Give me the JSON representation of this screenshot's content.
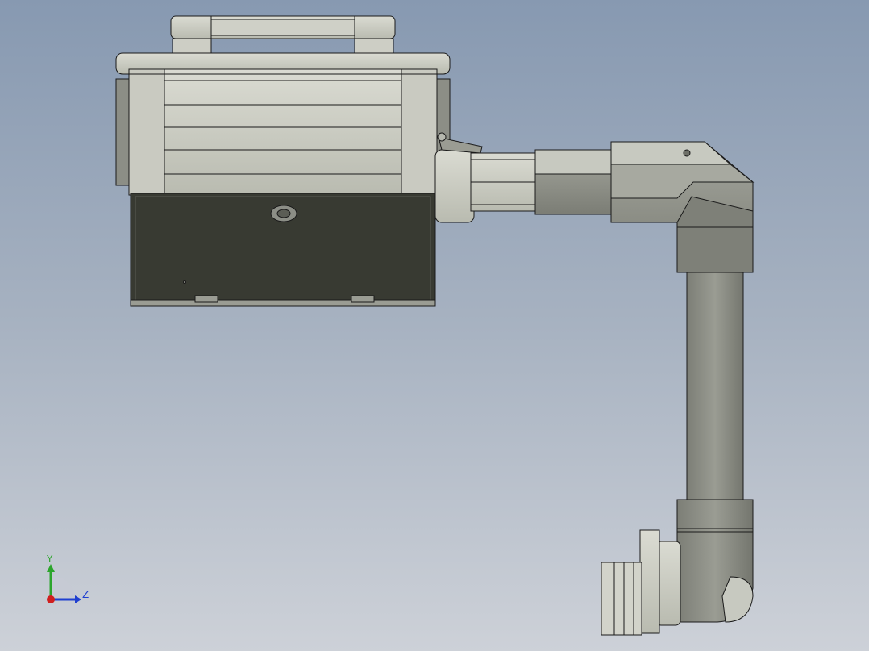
{
  "viewport": {
    "background_top": "#8799b1",
    "background_bottom": "#cdd1d8"
  },
  "model": {
    "parts": [
      "handle",
      "upper-housing",
      "lower-housing",
      "actuator-shaft",
      "elbow-joint",
      "vertical-arm",
      "wrist-joint",
      "end-flange"
    ],
    "colors": {
      "light_metal": "#c6c8bd",
      "dark_metal": "#8c8e86",
      "dark_panel": "#383a32",
      "edge": "#1a1a1a"
    }
  },
  "triad": {
    "y_label": "Y",
    "z_label": "Z",
    "y_color": "#2ca52c",
    "z_color": "#1f3fd0",
    "x_color": "#d01f1f"
  }
}
